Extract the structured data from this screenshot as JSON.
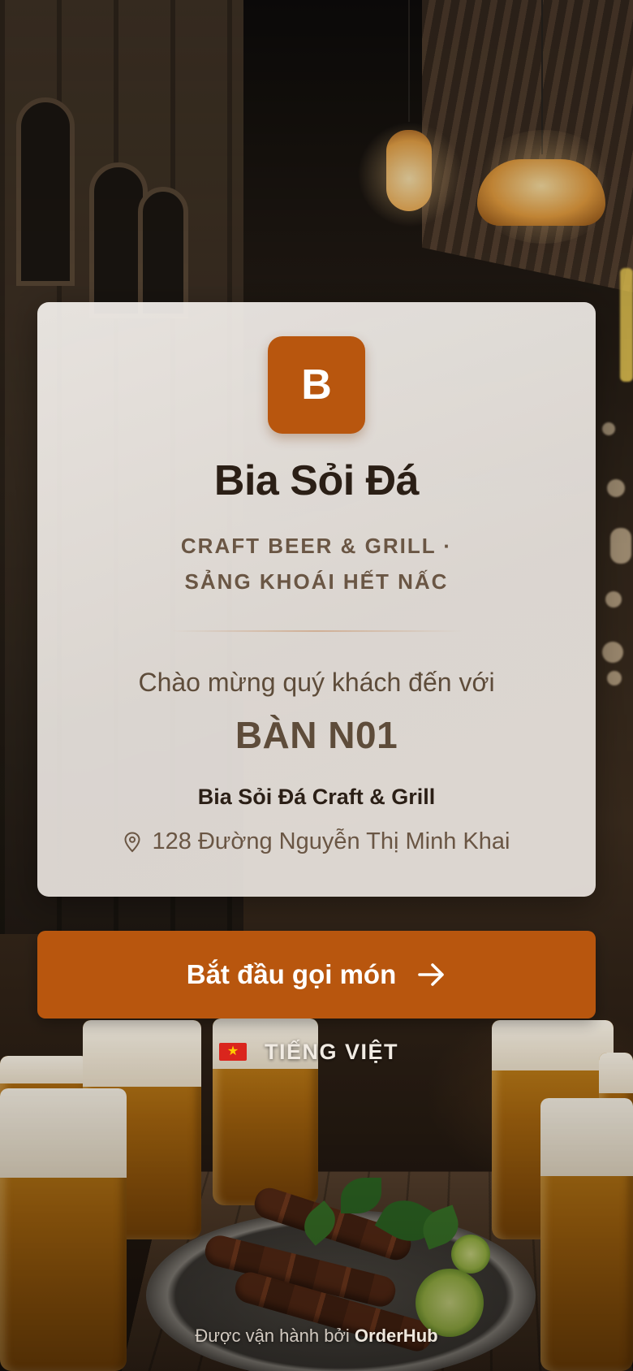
{
  "restaurant": {
    "logo_letter": "B",
    "name": "Bia Sỏi Đá",
    "tagline_line1": "CRAFT BEER & GRILL ·",
    "tagline_line2": "SẢNG KHOÁI HẾT NẤC"
  },
  "welcome": {
    "greeting": "Chào mừng quý khách đến với",
    "table": "BÀN N01",
    "branch_name": "Bia Sỏi Đá Craft & Grill",
    "address": "128 Đường Nguyễn Thị Minh Khai",
    "address_icon": "map-pin-icon"
  },
  "actions": {
    "start_order_label": "Bắt đầu gọi món",
    "start_order_icon": "arrow-right-icon"
  },
  "language": {
    "flag_icon": "vietnam-flag-icon",
    "label": "TIẾNG VIỆT"
  },
  "footer": {
    "prefix": "Được vận hành bởi",
    "brand": "OrderHub"
  },
  "colors": {
    "accent": "#b8560e",
    "heading": "#2b1f16",
    "muted": "#6a5644"
  }
}
